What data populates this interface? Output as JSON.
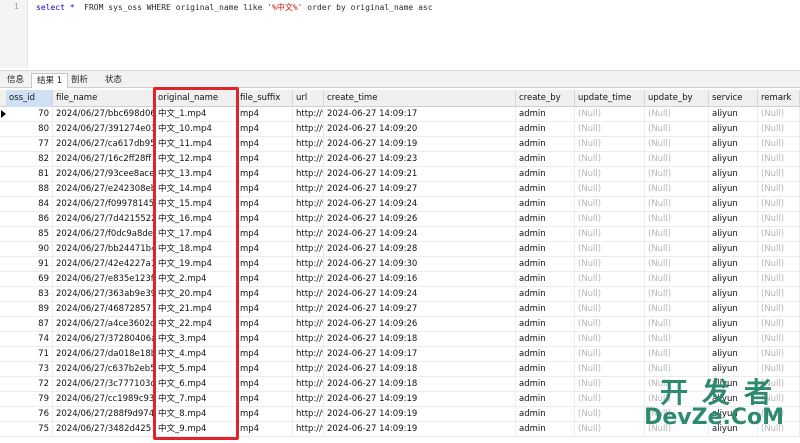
{
  "editor": {
    "line_number": "1",
    "sql_kw1": "select * ",
    "sql_mid1": " FROM sys_oss WHERE original_name like ",
    "sql_str": "'%中文%'",
    "sql_mid2": " order by original_name asc"
  },
  "tabs": [
    "信息",
    "结果 1",
    "剖析",
    "状态"
  ],
  "columns": [
    "oss_id",
    "file_name",
    "original_name",
    "file_suffix",
    "url",
    "create_time",
    "create_by",
    "update_time",
    "update_by",
    "service",
    "remark"
  ],
  "null_text": "(Null)",
  "rows": [
    {
      "oss_id": "70",
      "file_name": "2024/06/27/bbc698d06",
      "original_name": "中文_1.mp4",
      "file_suffix": "mp4",
      "url": "http://v",
      "create_time": "2024-06-27 14:09:17",
      "create_by": "admin",
      "service": "aliyun"
    },
    {
      "oss_id": "80",
      "file_name": "2024/06/27/391274e03",
      "original_name": "中文_10.mp4",
      "file_suffix": "mp4",
      "url": "http://v",
      "create_time": "2024-06-27 14:09:20",
      "create_by": "admin",
      "service": "aliyun"
    },
    {
      "oss_id": "77",
      "file_name": "2024/06/27/ca617db95",
      "original_name": "中文_11.mp4",
      "file_suffix": "mp4",
      "url": "http://v",
      "create_time": "2024-06-27 14:09:19",
      "create_by": "admin",
      "service": "aliyun"
    },
    {
      "oss_id": "82",
      "file_name": "2024/06/27/16c2ff28ff",
      "original_name": "中文_12.mp4",
      "file_suffix": "mp4",
      "url": "http://v",
      "create_time": "2024-06-27 14:09:23",
      "create_by": "admin",
      "service": "aliyun"
    },
    {
      "oss_id": "81",
      "file_name": "2024/06/27/93cee8ace",
      "original_name": "中文_13.mp4",
      "file_suffix": "mp4",
      "url": "http://v",
      "create_time": "2024-06-27 14:09:21",
      "create_by": "admin",
      "service": "aliyun"
    },
    {
      "oss_id": "88",
      "file_name": "2024/06/27/e242308eb",
      "original_name": "中文_14.mp4",
      "file_suffix": "mp4",
      "url": "http://v",
      "create_time": "2024-06-27 14:09:27",
      "create_by": "admin",
      "service": "aliyun"
    },
    {
      "oss_id": "84",
      "file_name": "2024/06/27/f09978145",
      "original_name": "中文_15.mp4",
      "file_suffix": "mp4",
      "url": "http://v",
      "create_time": "2024-06-27 14:09:24",
      "create_by": "admin",
      "service": "aliyun"
    },
    {
      "oss_id": "86",
      "file_name": "2024/06/27/7d4215522",
      "original_name": "中文_16.mp4",
      "file_suffix": "mp4",
      "url": "http://v",
      "create_time": "2024-06-27 14:09:26",
      "create_by": "admin",
      "service": "aliyun"
    },
    {
      "oss_id": "85",
      "file_name": "2024/06/27/f0dc9a8de",
      "original_name": "中文_17.mp4",
      "file_suffix": "mp4",
      "url": "http://v",
      "create_time": "2024-06-27 14:09:24",
      "create_by": "admin",
      "service": "aliyun"
    },
    {
      "oss_id": "90",
      "file_name": "2024/06/27/bb24471b4",
      "original_name": "中文_18.mp4",
      "file_suffix": "mp4",
      "url": "http://v",
      "create_time": "2024-06-27 14:09:28",
      "create_by": "admin",
      "service": "aliyun"
    },
    {
      "oss_id": "91",
      "file_name": "2024/06/27/42e4227a1",
      "original_name": "中文_19.mp4",
      "file_suffix": "mp4",
      "url": "http://v",
      "create_time": "2024-06-27 14:09:30",
      "create_by": "admin",
      "service": "aliyun"
    },
    {
      "oss_id": "69",
      "file_name": "2024/06/27/e835e123fa",
      "original_name": "中文_2.mp4",
      "file_suffix": "mp4",
      "url": "http://v",
      "create_time": "2024-06-27 14:09:16",
      "create_by": "admin",
      "service": "aliyun"
    },
    {
      "oss_id": "83",
      "file_name": "2024/06/27/363ab9e39",
      "original_name": "中文_20.mp4",
      "file_suffix": "mp4",
      "url": "http://v",
      "create_time": "2024-06-27 14:09:24",
      "create_by": "admin",
      "service": "aliyun"
    },
    {
      "oss_id": "89",
      "file_name": "2024/06/27/46872857",
      "original_name": "中文_21.mp4",
      "file_suffix": "mp4",
      "url": "http://v",
      "create_time": "2024-06-27 14:09:27",
      "create_by": "admin",
      "service": "aliyun"
    },
    {
      "oss_id": "87",
      "file_name": "2024/06/27/a4ce3602cf",
      "original_name": "中文_22.mp4",
      "file_suffix": "mp4",
      "url": "http://v",
      "create_time": "2024-06-27 14:09:26",
      "create_by": "admin",
      "service": "aliyun"
    },
    {
      "oss_id": "74",
      "file_name": "2024/06/27/37280406a",
      "original_name": "中文_3.mp4",
      "file_suffix": "mp4",
      "url": "http://v",
      "create_time": "2024-06-27 14:09:18",
      "create_by": "admin",
      "service": "aliyun"
    },
    {
      "oss_id": "71",
      "file_name": "2024/06/27/da018e18b",
      "original_name": "中文_4.mp4",
      "file_suffix": "mp4",
      "url": "http://v",
      "create_time": "2024-06-27 14:09:17",
      "create_by": "admin",
      "service": "aliyun"
    },
    {
      "oss_id": "73",
      "file_name": "2024/06/27/c637b2eb5",
      "original_name": "中文_5.mp4",
      "file_suffix": "mp4",
      "url": "http://v",
      "create_time": "2024-06-27 14:09:18",
      "create_by": "admin",
      "service": "aliyun"
    },
    {
      "oss_id": "72",
      "file_name": "2024/06/27/3c777103d",
      "original_name": "中文_6.mp4",
      "file_suffix": "mp4",
      "url": "http://v",
      "create_time": "2024-06-27 14:09:18",
      "create_by": "admin",
      "service": "aliyun"
    },
    {
      "oss_id": "79",
      "file_name": "2024/06/27/cc1989c93",
      "original_name": "中文_7.mp4",
      "file_suffix": "mp4",
      "url": "http://v",
      "create_time": "2024-06-27 14:09:19",
      "create_by": "admin",
      "service": "aliyun"
    },
    {
      "oss_id": "76",
      "file_name": "2024/06/27/288f9d974",
      "original_name": "中文_8.mp4",
      "file_suffix": "mp4",
      "url": "http://v",
      "create_time": "2024-06-27 14:09:19",
      "create_by": "admin",
      "service": "aliyun"
    },
    {
      "oss_id": "75",
      "file_name": "2024/06/27/3482d425",
      "original_name": "中文_9.mp4",
      "file_suffix": "mp4",
      "url": "http://v",
      "create_time": "2024-06-27 14:09:19",
      "create_by": "admin",
      "service": "aliyun"
    }
  ],
  "watermark": {
    "cn": "开发者",
    "en": "DevZe.CoM"
  },
  "colors": {
    "highlight": "#e0252a",
    "keyword": "#1c00cf",
    "string": "#c41a16",
    "watermark": "#2d8a6e"
  }
}
